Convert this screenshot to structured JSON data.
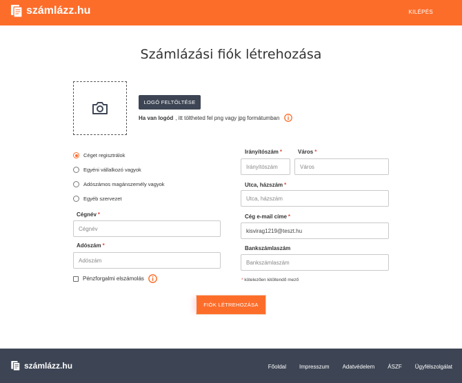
{
  "header": {
    "brand": "számlázz.hu",
    "logout": "KILÉPÉS"
  },
  "title": "Számlázási fiók létrehozása",
  "logo_upload": {
    "button": "LOGÓ FELTÖLTÉSE",
    "hint_bold": "Ha van logód",
    "hint_text": ", itt töltheted fel png vagy jpg formátumban"
  },
  "entity_types": [
    {
      "label": "Céget regisztrálok",
      "selected": true
    },
    {
      "label": "Egyéni vállalkozó vagyok",
      "selected": false
    },
    {
      "label": "Adószámos magánszemély vagyok",
      "selected": false
    },
    {
      "label": "Egyéb szervezet",
      "selected": false
    }
  ],
  "fields": {
    "company_name": {
      "label": "Cégnév",
      "placeholder": "Cégnév"
    },
    "tax_number": {
      "label": "Adószám",
      "placeholder": "Adószám"
    },
    "postal_code": {
      "label": "Irányítószám",
      "placeholder": "Irányítószám"
    },
    "city": {
      "label": "Város",
      "placeholder": "Város"
    },
    "street": {
      "label": "Utca, házszám",
      "placeholder": "Utca, házszám"
    },
    "email": {
      "label": "Cég e-mail címe",
      "value": "kisvirag1219@teszt.hu"
    },
    "bank_account": {
      "label": "Bankszámlaszám",
      "placeholder": "Bankszámlaszám"
    }
  },
  "cash_accounting": {
    "label": "Pénzforgalmi elszámolás",
    "checked": false
  },
  "required_note": "kötelezően kitöltendő mező",
  "required_mark": "*",
  "submit": "FIÓK LÉTREHOZÁSA",
  "footer": {
    "brand": "számlázz.hu",
    "links": [
      "Főoldal",
      "Impresszum",
      "Adatvédelem",
      "ÁSZF",
      "Ügyfélszolgálat"
    ]
  },
  "colors": {
    "accent": "#fd6d2a",
    "dark": "#3d4554",
    "required": "#e04a3f"
  },
  "icons": {
    "logo": "document-logo-icon",
    "camera": "camera-icon",
    "info": "info-circle-icon"
  }
}
